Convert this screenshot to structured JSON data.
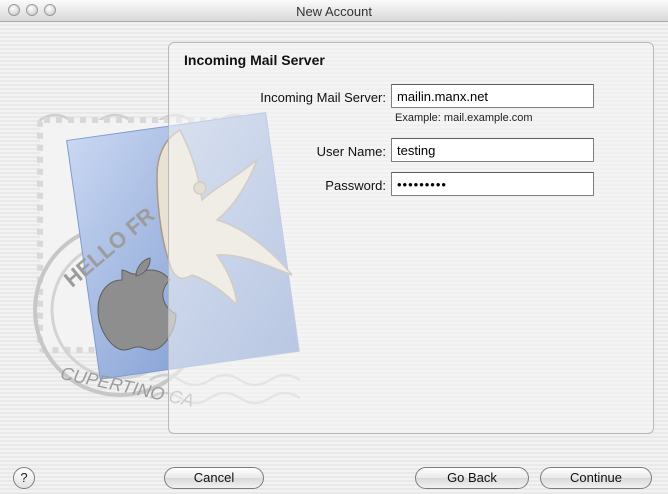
{
  "window": {
    "title": "New Account"
  },
  "section": {
    "title": "Incoming Mail Server"
  },
  "form": {
    "server_label": "Incoming Mail Server:",
    "server_value": "mailin.manx.net",
    "server_hint": "Example: mail.example.com",
    "username_label": "User Name:",
    "username_value": "testing",
    "password_label": "Password:",
    "password_value": "•••••••••"
  },
  "stamp": {
    "top_text": "HELLO FR",
    "bottom_text": "CUPERTINO CA"
  },
  "buttons": {
    "help": "?",
    "cancel": "Cancel",
    "go_back": "Go Back",
    "continue": "Continue"
  },
  "icons": {
    "help": "question-mark-icon",
    "stamp": "mail-stamp-icon",
    "eagle": "eagle-icon"
  }
}
